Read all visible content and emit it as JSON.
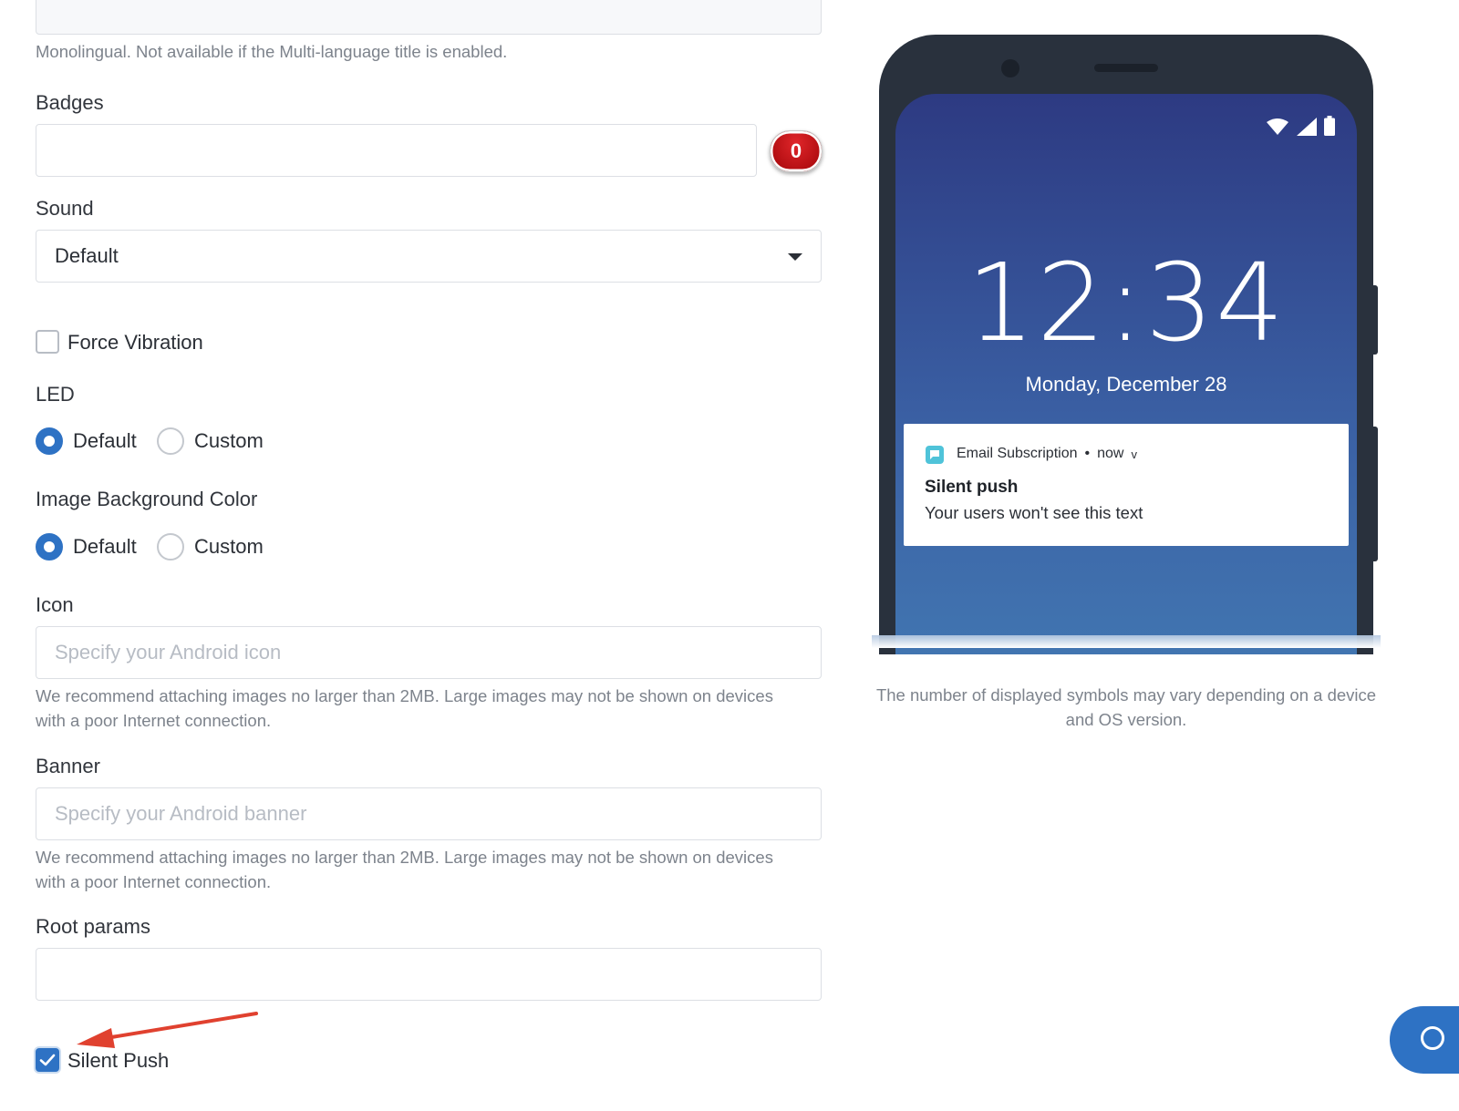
{
  "form": {
    "title_hint": "Monolingual. Not available if the Multi-language title is enabled.",
    "badges": {
      "label": "Badges",
      "value": "",
      "count": "0"
    },
    "sound": {
      "label": "Sound",
      "selected": "Default"
    },
    "force_vibration": {
      "label": "Force Vibration",
      "checked": false
    },
    "led": {
      "label": "LED",
      "options": [
        "Default",
        "Custom"
      ],
      "selected": "Default"
    },
    "image_bg_color": {
      "label": "Image Background Color",
      "options": [
        "Default",
        "Custom"
      ],
      "selected": "Default"
    },
    "icon": {
      "label": "Icon",
      "placeholder": "Specify your Android icon",
      "hint_line1": "We recommend attaching images no larger than 2MB. Large images may not be shown on devices",
      "hint_line2": "with a poor Internet connection."
    },
    "banner": {
      "label": "Banner",
      "placeholder": "Specify your Android banner",
      "hint_line1": "We recommend attaching images no larger than 2MB. Large images may not be shown on devices",
      "hint_line2": "with a poor Internet connection."
    },
    "root_params": {
      "label": "Root params",
      "value": ""
    },
    "silent_push": {
      "label": "Silent Push",
      "checked": true
    }
  },
  "preview": {
    "clock": "12:34",
    "date": "Monday, December 28",
    "notification": {
      "app_name": "Email Subscription",
      "separator": "•",
      "time": "now",
      "expand": "v",
      "title": "Silent push",
      "text": "Your users won't see this text"
    },
    "note_line1": "The number of displayed symbols may vary depending on a device",
    "note_line2": "and OS version."
  },
  "colors": {
    "accent": "#2e72c4",
    "badge_red": "#c2151a",
    "annotation_arrow": "#e0412f"
  }
}
